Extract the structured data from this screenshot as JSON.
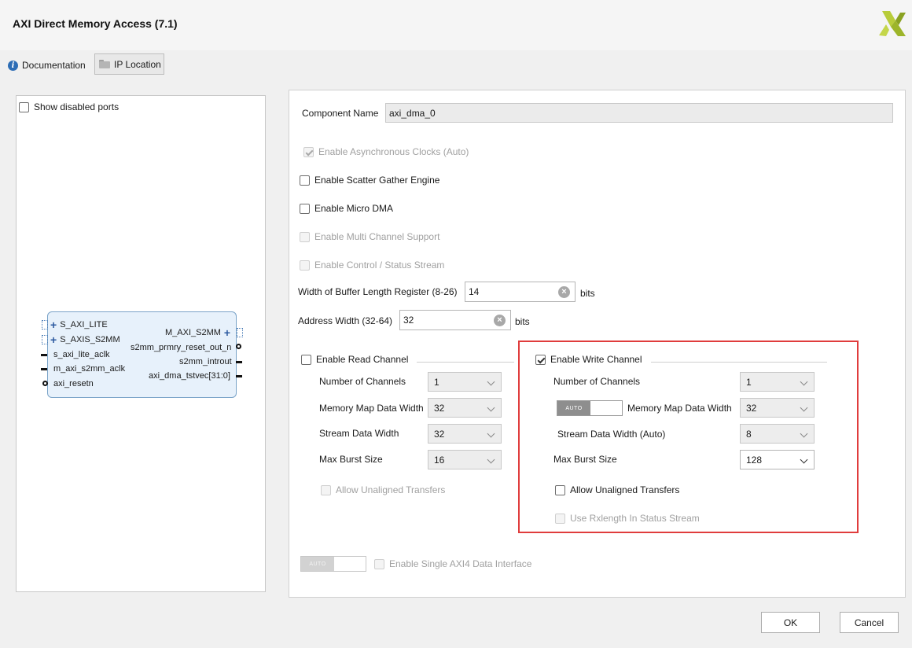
{
  "window": {
    "title": "AXI Direct Memory Access (7.1)"
  },
  "toolbar": {
    "documentation": "Documentation",
    "ip_location": "IP Location"
  },
  "left": {
    "show_disabled_ports": "Show disabled ports",
    "block": {
      "left_ports": [
        "S_AXI_LITE",
        "S_AXIS_S2MM",
        "s_axi_lite_aclk",
        "m_axi_s2mm_aclk",
        "axi_resetn"
      ],
      "right_ports": [
        "M_AXI_S2MM",
        "s2mm_prmry_reset_out_n",
        "s2mm_introut",
        "axi_dma_tstvec[31:0]"
      ]
    }
  },
  "config": {
    "component_name_label": "Component Name",
    "component_name": "axi_dma_0",
    "enable_async_clocks": "Enable Asynchronous Clocks (Auto)",
    "enable_sg": "Enable Scatter Gather Engine",
    "enable_micro_dma": "Enable Micro DMA",
    "enable_multi_channel": "Enable Multi Channel Support",
    "enable_control_status": "Enable Control / Status Stream",
    "buffer_len_label": "Width of Buffer Length Register (8-26)",
    "buffer_len_value": "14",
    "buffer_len_unit": "bits",
    "addr_width_label": "Address Width (32-64)",
    "addr_width_value": "32",
    "addr_width_unit": "bits",
    "read": {
      "title": "Enable Read Channel",
      "num_channels_label": "Number of Channels",
      "num_channels": "1",
      "mm_width_label": "Memory Map Data Width",
      "mm_width": "32",
      "stream_width_label": "Stream Data Width",
      "stream_width": "32",
      "burst_label": "Max Burst Size",
      "burst": "16",
      "unaligned": "Allow Unaligned Transfers"
    },
    "write": {
      "title": "Enable Write Channel",
      "num_channels_label": "Number of Channels",
      "num_channels": "1",
      "auto_label": "AUTO",
      "mm_width_label": "Memory Map Data Width",
      "mm_width": "32",
      "stream_width_label": "Stream Data Width (Auto)",
      "stream_width": "8",
      "burst_label": "Max Burst Size",
      "burst": "128",
      "unaligned": "Allow Unaligned Transfers",
      "rxlength": "Use Rxlength In Status Stream"
    },
    "single_axi_auto": "AUTO",
    "single_axi": "Enable Single AXI4 Data Interface"
  },
  "buttons": {
    "ok": "OK",
    "cancel": "Cancel"
  },
  "colors": {
    "highlight": "#e03c3c",
    "logo": "#a8c02c",
    "block_fill": "#e7f1fb"
  }
}
